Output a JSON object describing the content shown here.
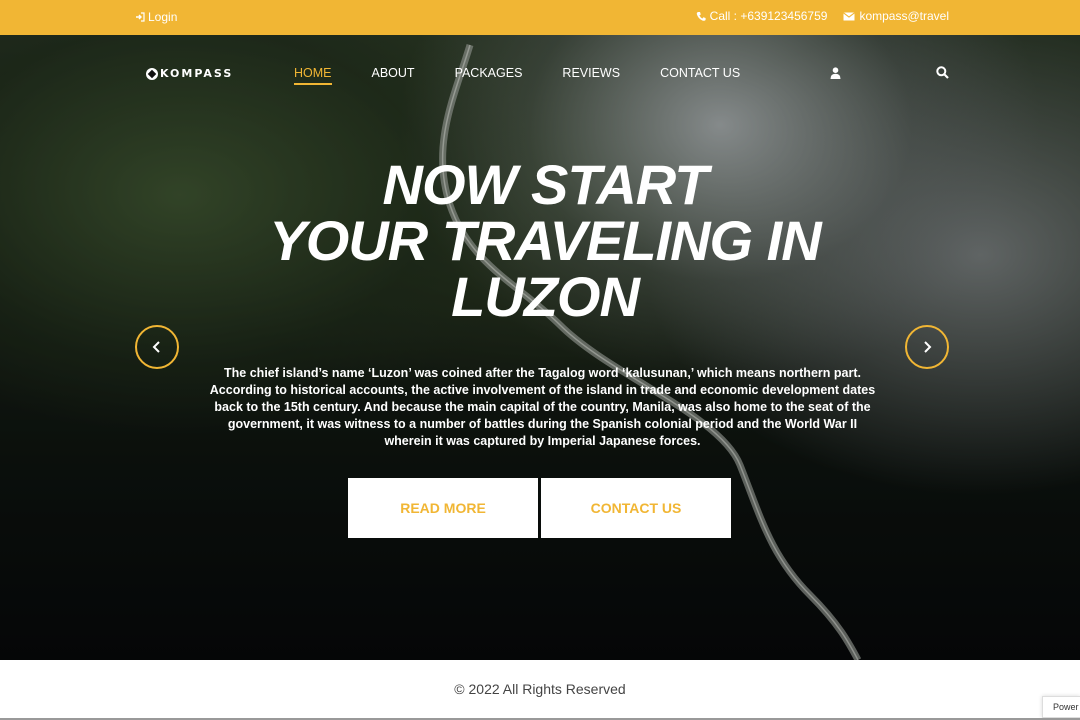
{
  "topbar": {
    "login_label": "Login",
    "phone_label": "Call : +639123456759",
    "email_label": "kompass@travel"
  },
  "nav": {
    "logo_text": "KOMPASS",
    "items": [
      {
        "label": "HOME",
        "active": true
      },
      {
        "label": "ABOUT",
        "active": false
      },
      {
        "label": "PACKAGES",
        "active": false
      },
      {
        "label": "REVIEWS",
        "active": false
      },
      {
        "label": "CONTACT US",
        "active": false
      }
    ],
    "user_icon": "user-icon",
    "search_icon": "search-icon"
  },
  "hero": {
    "headline_line1": "NOW START",
    "headline_line2": "YOUR TRAVELING IN",
    "headline_line3": "LUZON",
    "description": "The chief island’s name ‘Luzon’ was coined after the Tagalog word ‘kalusunan,’ which means northern part. According to historical accounts, the active involvement of the island in trade and economic development dates back to the 15th century. And because the main capital of the country, Manila, was also home to the seat of the government, it was witness to a number of battles during the Spanish colonial period and the World War II wherein it was captured by Imperial Japanese forces.",
    "read_more_label": "READ MORE",
    "contact_us_label": "CONTACT US",
    "prev_icon": "chevron-left-icon",
    "next_icon": "chevron-right-icon"
  },
  "footer": {
    "copyright": "© 2022 All Rights Reserved",
    "badge_text": "Power"
  },
  "colors": {
    "accent": "#f1b634",
    "white": "#ffffff"
  }
}
